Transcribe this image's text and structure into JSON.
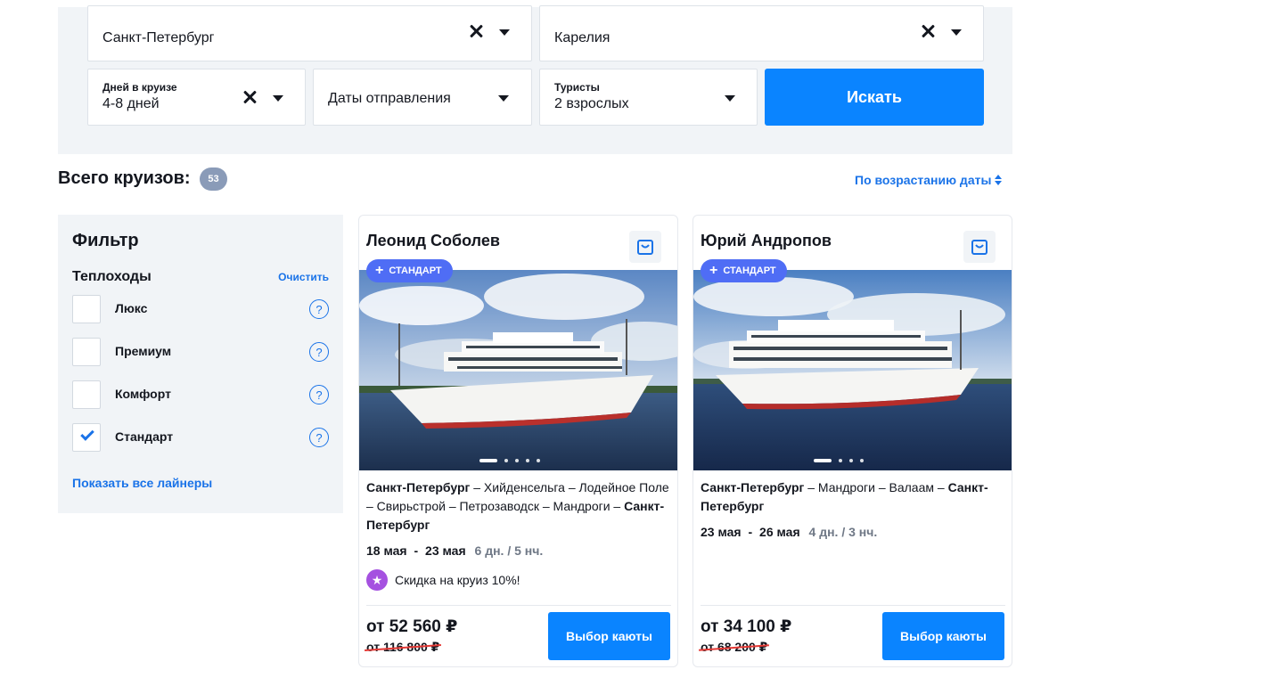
{
  "search": {
    "from_city": "Санкт-Петербург",
    "to_region": "Карелия",
    "days": {
      "caption": "Дней в круизе",
      "value": "4-8 дней"
    },
    "dates": {
      "value": "Даты отправления"
    },
    "tourists": {
      "caption": "Туристы",
      "value": "2 взрослых"
    },
    "submit_label": "Искать"
  },
  "totals": {
    "label": "Всего круизов:",
    "count": "53",
    "sort_label": "По возрастанию даты"
  },
  "filter": {
    "title": "Фильтр",
    "group_title": "Теплоходы",
    "clear_label": "Очистить",
    "options": [
      {
        "label": "Люкс",
        "checked": false
      },
      {
        "label": "Премиум",
        "checked": false
      },
      {
        "label": "Комфорт",
        "checked": false
      },
      {
        "label": "Стандарт",
        "checked": true
      }
    ],
    "help_glyph": "?",
    "show_all_label": "Показать все лайнеры"
  },
  "cards": [
    {
      "ship": "Леонид Соболев",
      "class_badge": "СТАНДАРТ",
      "route_start": "Санкт-Петербург",
      "route_middle": " – Хийденсельга – Лодейное Поле – Свирьстрой – Петрозаводск – Мандроги – ",
      "route_end": "Санкт-Петербург",
      "date_from": "18 мая",
      "date_sep": "-",
      "date_to": "23 мая",
      "duration": "6 дн. / 5 нч.",
      "promo": "Скидка на круиз 10%!",
      "price": "от 52 560 ₽",
      "old_price": "от 116 800 ₽",
      "cta": "Выбор каюты",
      "photo_slides": 5,
      "active_slide": 1
    },
    {
      "ship": "Юрий Андропов",
      "class_badge": "СТАНДАРТ",
      "route_start": "Санкт-Петербург",
      "route_middle": " – Мандроги – Валаам – ",
      "route_end": "Санкт-Петербург",
      "date_from": "23 мая",
      "date_sep": "-",
      "date_to": "26 мая",
      "duration": "4 дн. / 3 нч.",
      "price": "от 34 100 ₽",
      "old_price": "от 68 200 ₽",
      "cta": "Выбор каюты",
      "photo_slides": 4,
      "active_slide": 1
    }
  ],
  "icons": {
    "clear": "close-icon",
    "dropdown": "chevron-down-icon",
    "favorite": "shopping-bag-icon",
    "help": "help-circle-icon",
    "promo": "star-icon",
    "badge": "plus-icon"
  },
  "colors": {
    "accent": "#0a84ff",
    "link": "#1a73e8",
    "panel_bg": "#f1f4f7",
    "badge_bg": "#4f6df5",
    "promo_bg": "#a551e0",
    "strike": "#e53935",
    "count_badge_bg": "#8a9bb8"
  }
}
